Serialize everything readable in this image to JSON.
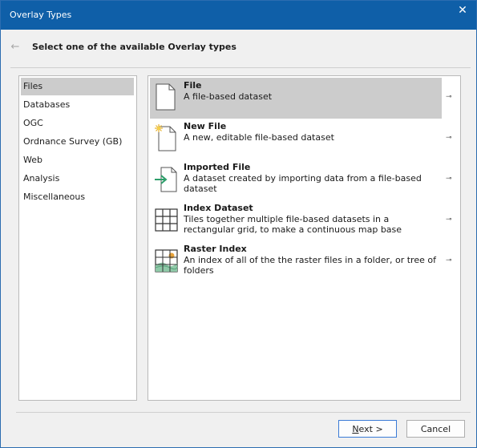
{
  "window": {
    "title": "Overlay Types"
  },
  "header": {
    "title": "Select one of the available Overlay types"
  },
  "categories": [
    {
      "label": "Files",
      "selected": true
    },
    {
      "label": "Databases"
    },
    {
      "label": "OGC"
    },
    {
      "label": "Ordnance Survey (GB)"
    },
    {
      "label": "Web"
    },
    {
      "label": "Analysis"
    },
    {
      "label": "Miscellaneous"
    }
  ],
  "items": [
    {
      "name": "File",
      "desc": "A file-based dataset",
      "icon": "file-icon",
      "selected": true
    },
    {
      "name": "New File",
      "desc": "A new, editable file-based dataset",
      "icon": "new-file-icon"
    },
    {
      "name": "Imported File",
      "desc": "A dataset created by importing data from a file-based dataset",
      "icon": "imported-file-icon"
    },
    {
      "name": "Index Dataset",
      "desc": "Tiles together multiple file-based datasets in a rectangular grid, to make a continuous map base",
      "icon": "grid-icon"
    },
    {
      "name": "Raster Index",
      "desc": "An index of all of the the raster files in a folder, or tree of folders",
      "icon": "raster-index-icon"
    }
  ],
  "buttons": {
    "next_mnemonic": "N",
    "next_rest": "ext >",
    "cancel": "Cancel"
  },
  "colors": {
    "titlebar": "#0f5fa8",
    "selection": "#cccccc",
    "arrow_green": "#2e9e6b",
    "sun_yellow": "#e8b22a"
  }
}
